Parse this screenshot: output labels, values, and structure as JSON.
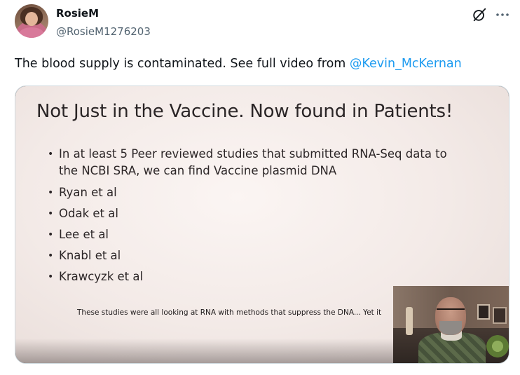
{
  "author": {
    "display_name": "RosieM",
    "handle": "@RosieM1276203"
  },
  "tweet": {
    "text": "The blood supply is contaminated. See full video from ",
    "mention": "@Kevin_McKernan"
  },
  "header_icons": {
    "grok": "grok-icon",
    "more": "more-options-icon"
  },
  "media": {
    "type": "video",
    "slide": {
      "title": "Not Just in the Vaccine. Now found in Patients!",
      "bullets": [
        {
          "line1": "In at least 5 Peer reviewed studies that submitted RNA-Seq data to",
          "line2": "the NCBI SRA, we can find Vaccine plasmid DNA"
        },
        {
          "line1": "Ryan et al"
        },
        {
          "line1": "Odak et al"
        },
        {
          "line1": "Lee et al"
        },
        {
          "line1": "Knabl et al"
        },
        {
          "line1": "Krawcyzk et al"
        }
      ],
      "footnote": "These studies were all looking at RNA with methods that suppress the DNA... Yet it"
    }
  },
  "colors": {
    "text_primary": "#0f1419",
    "text_secondary": "#536471",
    "link": "#1d9bf0",
    "border": "#cfd9de"
  }
}
